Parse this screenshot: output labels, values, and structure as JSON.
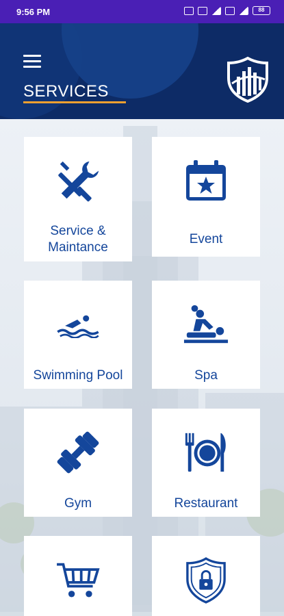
{
  "status_bar": {
    "time": "9:56 PM",
    "battery": "88"
  },
  "header": {
    "title": "SERVICES"
  },
  "colors": {
    "header_bg": "#0d2b66",
    "accent_underline": "#f0a030",
    "icon_blue": "#14469b",
    "status_bar_bg": "#4a1fb5"
  },
  "tiles": [
    {
      "label_line1": "Service &",
      "label_line2": "Maintance",
      "icon": "tools-icon"
    },
    {
      "label": "Event",
      "icon": "calendar-star-icon"
    },
    {
      "label": "Swimming Pool",
      "icon": "swimmer-icon"
    },
    {
      "label": "Spa",
      "icon": "massage-icon"
    },
    {
      "label": "Gym",
      "icon": "dumbbell-icon"
    },
    {
      "label": "Restaurant",
      "icon": "plate-cutlery-icon"
    },
    {
      "label": "",
      "icon": "shopping-cart-icon"
    },
    {
      "label": "",
      "icon": "shield-lock-icon"
    }
  ]
}
